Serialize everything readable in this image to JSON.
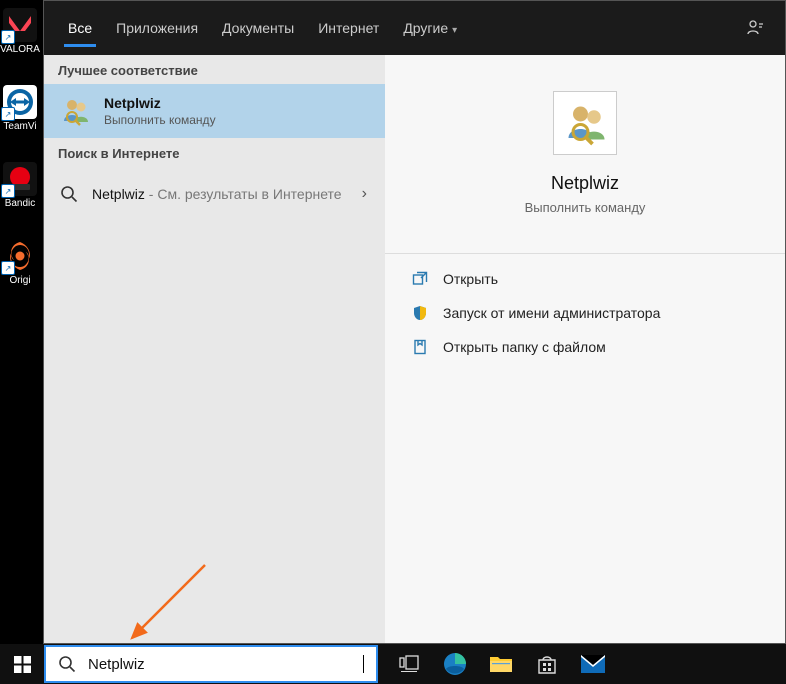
{
  "desktop": {
    "icons": [
      {
        "name": "valorant",
        "label": "VALORA"
      },
      {
        "name": "teamviewer",
        "label": "TeamVi"
      },
      {
        "name": "bandicam",
        "label": "Bandic"
      },
      {
        "name": "origin",
        "label": "Origi"
      }
    ]
  },
  "tabs": {
    "all": "Все",
    "apps": "Приложения",
    "docs": "Документы",
    "web": "Интернет",
    "more": "Другие"
  },
  "left": {
    "best_match": "Лучшее соответствие",
    "result_title": "Netplwiz",
    "result_sub": "Выполнить команду",
    "web_search": "Поиск в Интернете",
    "web_result_title": "Netplwiz",
    "web_result_sub": " - См. результаты в Интернете"
  },
  "right": {
    "title": "Netplwiz",
    "sub": "Выполнить команду",
    "open": "Открыть",
    "runadmin": "Запуск от имени администратора",
    "openloc": "Открыть папку с файлом"
  },
  "search": {
    "value": "Netplwiz"
  }
}
